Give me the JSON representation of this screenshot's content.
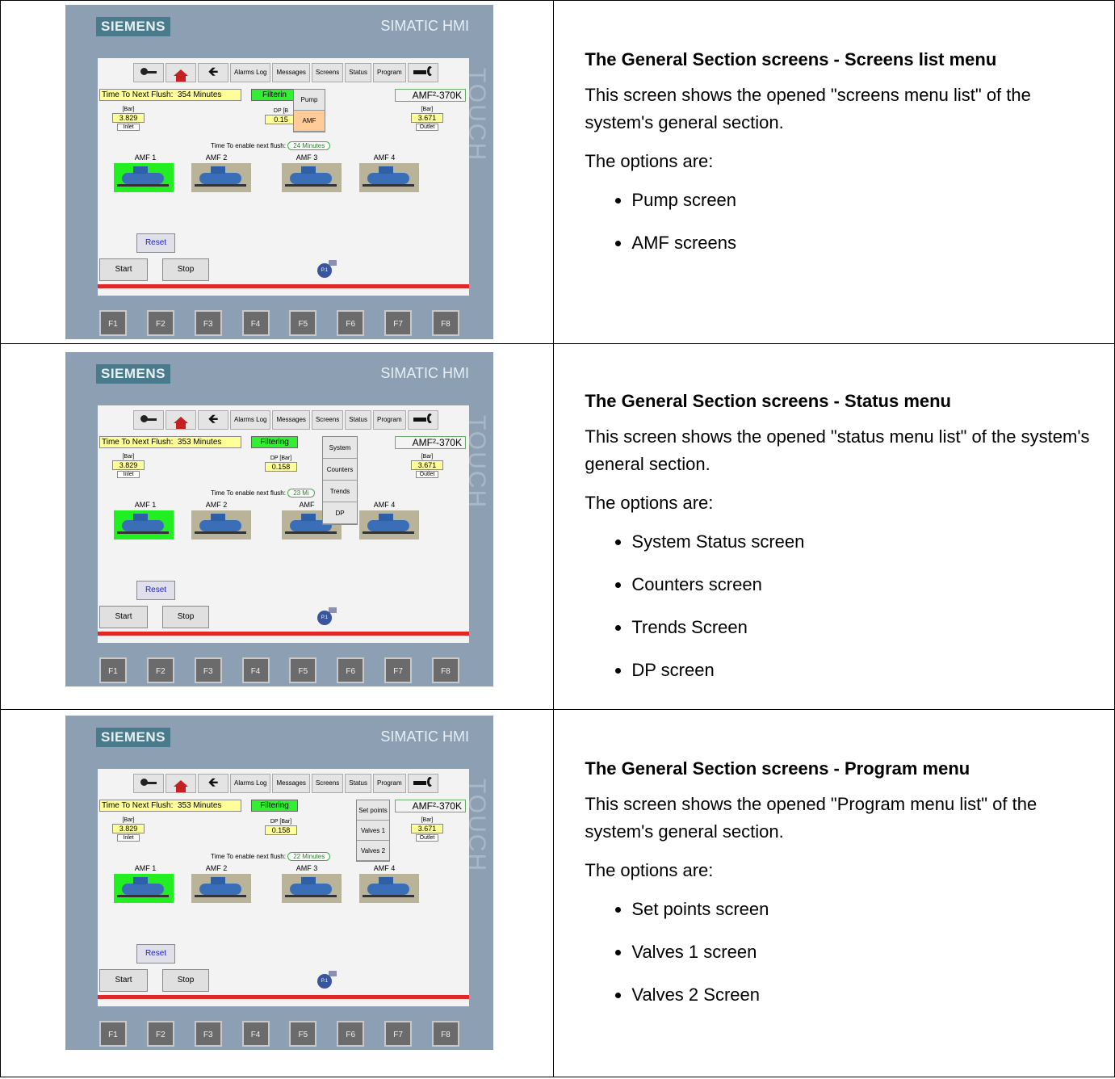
{
  "hmi": {
    "brand": "SIEMENS",
    "model": "SIMATIC HMI",
    "touch": "TOUCH",
    "fkeys": [
      "F1",
      "F2",
      "F3",
      "F4",
      "F5",
      "F6",
      "F7",
      "F8"
    ]
  },
  "rows": [
    {
      "nav": {
        "alarms_log": "Alarms Log",
        "messages": "Messages",
        "screens": "Screens",
        "status": "Status",
        "program": "Program"
      },
      "flush_label": "Time To Next Flush:",
      "flush_value": "354 Minutes",
      "filter_status": "Filterin",
      "amf_model": "AMF²-370K",
      "inlet": {
        "unit": "[Bar]",
        "value": "3.829",
        "label": "Inlet"
      },
      "dp": {
        "label": "DP [B",
        "value": "0.15"
      },
      "outlet": {
        "unit": "[Bar]",
        "value": "3.671",
        "label": "Outlet"
      },
      "next_flush_label": "Time To enable next flush:",
      "next_flush_value": "24 Minutes",
      "amf_labels": [
        "AMF 1",
        "AMF 2",
        "AMF 3",
        "AMF 4"
      ],
      "reset": "Reset",
      "start": "Start",
      "stop": "Stop",
      "pump_label": "P.1",
      "menu_items": [
        "Pump",
        "AMF"
      ],
      "selected_menu_item": "AMF",
      "title": "The General Section screens - Screens list menu",
      "description": "This screen shows the opened \"screens menu list\" of the system's general section.",
      "options_intro": "The options are:",
      "options": [
        "Pump screen",
        "AMF screens"
      ]
    },
    {
      "nav": {
        "alarms_log": "Alarms Log",
        "messages": "Messages",
        "screens": "Screens",
        "status": "Status",
        "program": "Program"
      },
      "flush_label": "Time To Next Flush:",
      "flush_value": "353 Minutes",
      "filter_status": "Filtering",
      "amf_model": "AMF²-370K",
      "inlet": {
        "unit": "[Bar]",
        "value": "3.829",
        "label": "Inlet"
      },
      "dp": {
        "label": "DP [Bar]",
        "value": "0.158"
      },
      "outlet": {
        "unit": "[Bar]",
        "value": "3.671",
        "label": "Outlet"
      },
      "next_flush_label": "Time To enable next flush:",
      "next_flush_value": "23 Mi",
      "amf_labels": [
        "AMF 1",
        "AMF 2",
        "AMF",
        "AMF 4"
      ],
      "reset": "Reset",
      "start": "Start",
      "stop": "Stop",
      "pump_label": "P.1",
      "menu_items": [
        "System",
        "Counters",
        "Trends",
        "DP"
      ],
      "title": "The General Section screens - Status menu",
      "description": "This screen shows the opened \"status menu list\" of the system's general section.",
      "options_intro": "The options are:",
      "options": [
        "System Status screen",
        "Counters screen",
        "Trends Screen",
        "DP screen"
      ]
    },
    {
      "nav": {
        "alarms_log": "Alarms Log",
        "messages": "Messages",
        "screens": "Screens",
        "status": "Status",
        "program": "Program"
      },
      "flush_label": "Time To Next Flush:",
      "flush_value": "353 Minutes",
      "filter_status": "Filtering",
      "amf_model": "AMF²-370K",
      "inlet": {
        "unit": "[Bar]",
        "value": "3.829",
        "label": "Inlet"
      },
      "dp": {
        "label": "DP [Bar]",
        "value": "0.158"
      },
      "outlet": {
        "unit": "[Bar]",
        "value": "3.671",
        "label": "Outlet"
      },
      "next_flush_label": "Time To enable next flush:",
      "next_flush_value": "22 Minutes",
      "amf_labels": [
        "AMF 1",
        "AMF 2",
        "AMF 3",
        "AMF 4"
      ],
      "reset": "Reset",
      "start": "Start",
      "stop": "Stop",
      "pump_label": "P.1",
      "menu_items": [
        "Set points",
        "Valves 1",
        "Valves 2"
      ],
      "title": "The General Section screens - Program menu",
      "description": "This screen shows the opened \"Program menu list\" of the system's general section.",
      "options_intro": "The options are:",
      "options": [
        "Set points screen",
        "Valves 1 screen",
        "Valves 2 Screen"
      ]
    }
  ]
}
